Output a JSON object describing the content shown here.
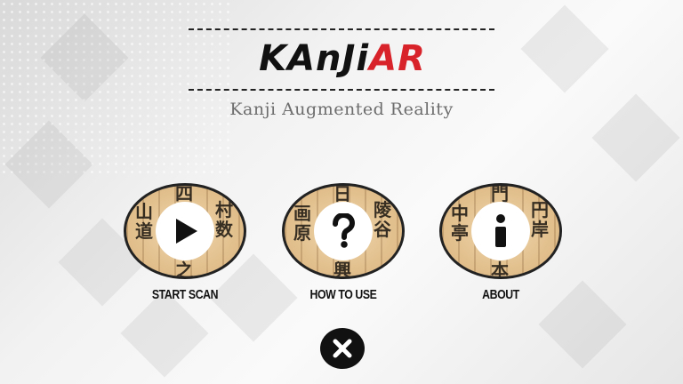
{
  "app": {
    "logo_main": "KAnJi",
    "logo_accent": "AR",
    "subtitle": "Kanji Augmented Reality"
  },
  "menu": {
    "items": [
      {
        "label": "START SCAN",
        "icon": "play-icon"
      },
      {
        "label": "HOW TO USE",
        "icon": "question-icon"
      },
      {
        "label": "ABOUT",
        "icon": "info-icon"
      }
    ]
  },
  "footer": {
    "close_icon": "close-icon"
  },
  "colors": {
    "accent": "#d9232a",
    "text": "#111111",
    "subtitle": "#6d6d6d",
    "button_paper": "#e7c79b"
  }
}
